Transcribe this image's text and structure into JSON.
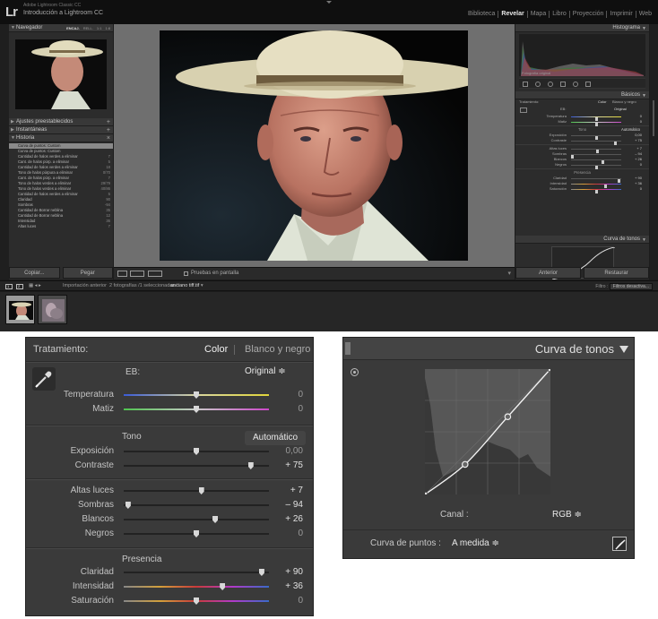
{
  "app": {
    "logo": "Lr",
    "subtitle": "Adobe Lightroom Classic CC",
    "name": "Introducción a Lightroom CC",
    "modules": [
      "Biblioteca",
      "Revelar",
      "Mapa",
      "Libro",
      "Proyección",
      "Imprimir",
      "Web"
    ],
    "active_module": "Revelar"
  },
  "left_panel": {
    "navigator_title": "Navegador",
    "navigator_modes": [
      "ENCAJ.",
      "RELL.",
      "1:1",
      "1:8"
    ],
    "presets_title": "Ajustes preestablecidos",
    "snapshots_title": "Instantáneas",
    "history_title": "Historia",
    "history": [
      {
        "label": "Curva de puntos: Custom",
        "v1": "",
        "v2": ""
      },
      {
        "label": "Curva de puntos: Custom",
        "v1": "",
        "v2": ""
      },
      {
        "label": "Cantidad de halos verdes a eliminar",
        "v1": "",
        "v2": "7"
      },
      {
        "label": "Cant. de halos púrp. a eliminar",
        "v1": "",
        "v2": "5"
      },
      {
        "label": "Cantidad de halos verdes a eliminar",
        "v1": "",
        "v2": "18"
      },
      {
        "label": "Tono de halos púrpura a eliminar",
        "v1": "",
        "v2": "0/70"
      },
      {
        "label": "Cant. de halos púrp. a eliminar",
        "v1": "",
        "v2": "7"
      },
      {
        "label": "Tono de halos verdes a eliminar",
        "v1": "",
        "v2": "29/79"
      },
      {
        "label": "Tono de halos verdes a eliminar",
        "v1": "",
        "v2": "40/86"
      },
      {
        "label": "Cantidad de halos verdes a eliminar",
        "v1": "",
        "v2": "5"
      },
      {
        "label": "Claridad",
        "v1": "",
        "v2": "90"
      },
      {
        "label": "Sombras",
        "v1": "",
        "v2": "-94"
      },
      {
        "label": "Cantidad de Borrar neblina",
        "v1": "",
        "v2": "35"
      },
      {
        "label": "Cantidad de Borrar neblina",
        "v1": "",
        "v2": "12"
      },
      {
        "label": "Intensidad",
        "v1": "",
        "v2": "36"
      },
      {
        "label": "Altas luces",
        "v1": "",
        "v2": "7"
      }
    ],
    "copy_button": "Copiar...",
    "paste_button": "Pegar"
  },
  "center_toolbar": {
    "soft_proof_label": "Pruebas en pantalla"
  },
  "right_panel": {
    "histogram_title": "Histograma",
    "original_photo": "Fotografía original",
    "basics_title": "Básicos",
    "tone_curve_title": "Curva de tonos",
    "previous_button": "Anterior",
    "reset_button": "Restaurar",
    "mini_treatment": "Tratamiento:",
    "mini_color": "Color",
    "mini_bw": "Blanco y negro",
    "mini_eb": "EB:",
    "mini_eb_value": "Original",
    "mini_tone": "Tono",
    "mini_auto": "Automático",
    "mini_presence": "Presencia"
  },
  "filmbar": {
    "screen1": "1",
    "screen2": "2",
    "import_label": "Importación anterior",
    "count_label": "2 fotografías /1 seleccionadas /",
    "file_name": "anciano tiff.tif",
    "filter_label": "Filtro :",
    "filter_value": "Filtros desactiva..."
  },
  "basic_panel": {
    "treatment_label": "Tratamiento:",
    "color_label": "Color",
    "bw_label": "Blanco y negro",
    "eb_label": "EB:",
    "eb_value": "Original ≑",
    "tone_section": "Tono",
    "auto_button": "Automático",
    "presence_section": "Presencia",
    "sliders": [
      {
        "id": "temp",
        "label": "Temperatura",
        "value": "0",
        "position": 0.5,
        "gradient": "temp"
      },
      {
        "id": "tint",
        "label": "Matiz",
        "value": "0",
        "position": 0.5,
        "gradient": "tint"
      },
      {
        "id": "exposure",
        "label": "Exposición",
        "value": "0,00",
        "position": 0.5,
        "gradient": "none"
      },
      {
        "id": "contrast",
        "label": "Contraste",
        "value": "+ 75",
        "position": 0.875,
        "gradient": "none"
      },
      {
        "id": "highlights",
        "label": "Altas luces",
        "value": "+ 7",
        "position": 0.535,
        "gradient": "none"
      },
      {
        "id": "shadows",
        "label": "Sombras",
        "value": "– 94",
        "position": 0.03,
        "gradient": "none"
      },
      {
        "id": "whites",
        "label": "Blancos",
        "value": "+ 26",
        "position": 0.63,
        "gradient": "none"
      },
      {
        "id": "blacks",
        "label": "Negros",
        "value": "0",
        "position": 0.5,
        "gradient": "none"
      },
      {
        "id": "clarity",
        "label": "Claridad",
        "value": "+ 90",
        "position": 0.95,
        "gradient": "none"
      },
      {
        "id": "vibrance",
        "label": "Intensidad",
        "value": "+ 36",
        "position": 0.68,
        "gradient": "sat"
      },
      {
        "id": "saturation",
        "label": "Saturación",
        "value": "0",
        "position": 0.5,
        "gradient": "sat"
      }
    ]
  },
  "tone_curve": {
    "title": "Curva de tonos",
    "channel_label": "Canal :",
    "channel_value": "RGB ≑",
    "points_label": "Curva de puntos :",
    "points_value": "A medida ≑",
    "curve_points": [
      [
        0,
        0
      ],
      [
        0.32,
        0.24
      ],
      [
        0.66,
        0.62
      ],
      [
        1,
        1
      ]
    ]
  },
  "colors": {
    "panel_bg": "#3a3a3a",
    "window_bg": "#1c1c1c"
  }
}
